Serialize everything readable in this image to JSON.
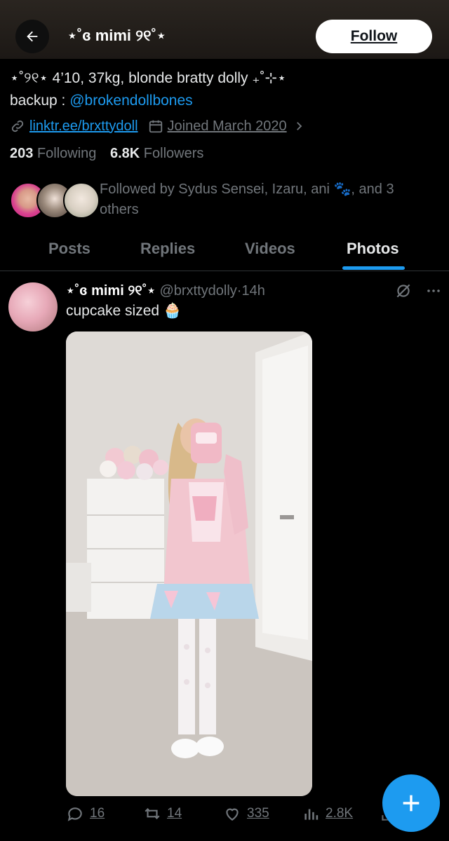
{
  "header": {
    "display_name": "⋆˚ɞ mimi ୨୧˚⋆",
    "follow_label": "Follow"
  },
  "profile": {
    "bio_line1": "⋆˚୨୧⋆ 4’10, 37kg, blonde bratty dolly ₊˚⊹⋆",
    "bio_backup_prefix": "backup : ",
    "bio_backup_handle": "@brokendollbones",
    "link": "linktr.ee/brxttydoll",
    "joined": "Joined March 2020",
    "following_count": "203",
    "following_label": "Following",
    "followers_count": "6.8K",
    "followers_label": "Followers",
    "followed_by": "Followed by Sydus Sensei, Izaru, ani 🐾, and 3 others"
  },
  "tabs": [
    {
      "label": "Posts"
    },
    {
      "label": "Replies"
    },
    {
      "label": "Videos"
    },
    {
      "label": "Photos",
      "active": true
    }
  ],
  "post": {
    "author_name": "⋆˚ɞ mimi ୨୧˚⋆",
    "handle": "@brxttydolly",
    "time": "14h",
    "text": "cupcake sized 🧁",
    "replies": "16",
    "reposts": "14",
    "likes": "335",
    "views": "2.8K"
  },
  "colors": {
    "accent": "#1d9bf0",
    "background": "#000000",
    "muted": "#71767b"
  },
  "icons": [
    "back-arrow-icon",
    "link-icon",
    "calendar-icon",
    "chevron-right-icon",
    "grok-icon",
    "more-icon",
    "reply-icon",
    "repost-icon",
    "like-icon",
    "views-icon",
    "share-icon",
    "plus-icon"
  ]
}
